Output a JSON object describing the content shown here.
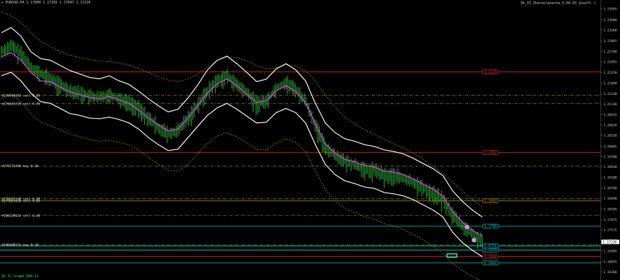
{
  "window": {
    "symbol_header": "EURUSD,H4",
    "ohlc": "1.17880 1.17256 1.17047 1.17226",
    "indicator_name": "Zb_33_Zhuravlenecha_V-04-03_1bsoft ⓘ"
  },
  "colors": {
    "background": "#000000",
    "candle": "#2ecc40",
    "bands": "#ffffff",
    "ma": "#ff33ff",
    "trend": "#8a8a00",
    "support": "#ff2a2a",
    "cyan": "#00d8e0",
    "gold": "#c8a000"
  },
  "price_axis": {
    "min": 1.1612,
    "max": 1.2425,
    "ticks": [
      "1.24250",
      "1.23995",
      "1.23680",
      "1.23380",
      "1.23065",
      "1.22760",
      "1.22455",
      "1.22150",
      "1.21840",
      "1.21530",
      "1.21230",
      "1.20925",
      "1.20620",
      "1.20320",
      "1.20005",
      "1.19700",
      "1.19410",
      "1.19100",
      "1.18790",
      "1.18490",
      "1.18185",
      "1.17875",
      "1.17575",
      "1.17265",
      "1.16965",
      "1.16655",
      "1.16360"
    ],
    "current_price": "1.17226"
  },
  "price_lines": [
    {
      "price": 1.2216,
      "color": "#ff2a2a",
      "style": "solid",
      "label": "1.2216",
      "tag_color": "#ff2a2a"
    },
    {
      "price": 1.2148,
      "color": "#8a7a00",
      "style": "dashed",
      "label": "",
      "tag_color": ""
    },
    {
      "price": 1.2124,
      "color": "#8a7a00",
      "style": "dashed",
      "label": "",
      "tag_color": ""
    },
    {
      "price": 1.1982,
      "color": "#ff2a2a",
      "style": "solid",
      "label": "1.1982",
      "tag_color": "#ff2a2a"
    },
    {
      "price": 1.1943,
      "color": "#8a7a00",
      "style": "dashed",
      "label": "",
      "tag_color": ""
    },
    {
      "price": 1.1848,
      "color": "#c8a000",
      "style": "dashed",
      "label": "",
      "tag_color": ""
    },
    {
      "price": 1.1842,
      "color": "#c8a000",
      "style": "solid",
      "label": "1.1842",
      "tag_color": "#c8a000"
    },
    {
      "price": 1.1799,
      "color": "#8a7a00",
      "style": "dashed",
      "label": "",
      "tag_color": ""
    },
    {
      "price": 1.1768,
      "color": "#00d8e0",
      "style": "solid",
      "label": "1.1768",
      "tag_color": "#00d8e0"
    },
    {
      "price": 1.1714,
      "color": "#8a7a00",
      "style": "dashed",
      "label": "",
      "tag_color": ""
    },
    {
      "price": 1.1711,
      "color": "#00d8e0",
      "style": "solid",
      "label": "1.1711",
      "tag_color": "#00d8e0"
    },
    {
      "price": 1.1699,
      "color": "#00d8e0",
      "style": "solid",
      "label": "1.1699",
      "tag_color": "#00d8e0"
    },
    {
      "price": 1.168,
      "color": "#ff2a2a",
      "style": "solid",
      "label": "1.1680",
      "tag_color": "#ff2a2a"
    },
    {
      "price": 1.1662,
      "color": "#00d8e0",
      "style": "solid",
      "label": "1.1662",
      "tag_color": "#00d8e0"
    }
  ],
  "order_labels": [
    {
      "price": 1.2148,
      "text": "#278694583 sell 0.05"
    },
    {
      "price": 1.2124,
      "text": "#278651519 sell 0.05"
    },
    {
      "price": 1.1943,
      "text": "#279273496 buy 0.30"
    },
    {
      "price": 1.1848,
      "text": "#278651540 sell 0.05"
    },
    {
      "price": 1.1842,
      "text": "#279051636 sell 0.05"
    },
    {
      "price": 1.1799,
      "text": "#280239632 sell 0.05"
    },
    {
      "price": 1.1714,
      "text": "#280408151 buy 0.30"
    }
  ],
  "footer_label": "Zb Ti Graph_V04-11",
  "chart_data": {
    "type": "line",
    "y_unit": "EURUSD price",
    "ylim": [
      1.1612,
      1.2425
    ],
    "series": [
      {
        "name": "",
        "role": "candle-mid",
        "values": [
          1.2275,
          1.2292,
          1.2268,
          1.223,
          1.221,
          1.2195,
          1.2178,
          1.2162,
          1.2155,
          1.2145,
          1.214,
          1.215,
          1.2138,
          1.2128,
          1.211,
          1.208,
          1.2055,
          1.2035,
          1.2045,
          1.208,
          1.212,
          1.216,
          1.219,
          1.2205,
          1.2178,
          1.2155,
          1.2125,
          1.213,
          1.2168,
          1.2185,
          1.2165,
          1.213,
          1.206,
          1.1998,
          1.1975,
          1.1955,
          1.1948,
          1.193,
          1.1932,
          1.1915,
          1.1915,
          1.1905,
          1.1895,
          1.1878,
          1.1864,
          1.1845,
          1.18,
          1.1768,
          1.1745,
          1.1722
        ]
      },
      {
        "name": "",
        "role": "ma",
        "values": [
          1.226,
          1.2272,
          1.225,
          1.2215,
          1.219,
          1.2188,
          1.2172,
          1.2158,
          1.215,
          1.2142,
          1.2138,
          1.2145,
          1.2135,
          1.2125,
          1.2105,
          1.2082,
          1.2062,
          1.2045,
          1.205,
          1.2082,
          1.2118,
          1.2155,
          1.2182,
          1.2196,
          1.2176,
          1.2152,
          1.2128,
          1.2132,
          1.2162,
          1.2176,
          1.216,
          1.2128,
          1.2065,
          1.2008,
          1.198,
          1.1962,
          1.1955,
          1.1945,
          1.194,
          1.1928,
          1.1925,
          1.1918,
          1.1905,
          1.189,
          1.1876,
          1.1855,
          1.181,
          1.178,
          1.1756,
          1.174
        ]
      },
      {
        "name": "",
        "role": "upper-band",
        "values": [
          1.233,
          1.2345,
          1.232,
          1.2275,
          1.2255,
          1.225,
          1.2235,
          1.222,
          1.221,
          1.22,
          1.2196,
          1.2205,
          1.219,
          1.218,
          1.216,
          1.2138,
          1.2118,
          1.21,
          1.2108,
          1.214,
          1.2178,
          1.2222,
          1.225,
          1.2262,
          1.224,
          1.2215,
          1.2188,
          1.2195,
          1.2225,
          1.224,
          1.2222,
          1.219,
          1.2125,
          1.2068,
          1.204,
          1.2022,
          1.2015,
          1.2005,
          1.2,
          1.199,
          1.1985,
          1.1978,
          1.1965,
          1.195,
          1.1935,
          1.1915,
          1.187,
          1.184,
          1.1815,
          1.1795
        ]
      },
      {
        "name": "",
        "role": "lower-band",
        "values": [
          1.2205,
          1.2215,
          1.219,
          1.2155,
          1.213,
          1.2125,
          1.211,
          1.2095,
          1.209,
          1.2082,
          1.208,
          1.2085,
          1.2078,
          1.2068,
          1.205,
          1.2025,
          1.2005,
          1.1988,
          1.1992,
          1.2025,
          1.2058,
          1.209,
          1.2112,
          1.2125,
          1.2108,
          1.2088,
          1.2068,
          1.207,
          1.2098,
          1.211,
          1.2098,
          1.2068,
          1.2005,
          1.1948,
          1.1918,
          1.19,
          1.1892,
          1.1882,
          1.1878,
          1.1866,
          1.1862,
          1.1856,
          1.1845,
          1.183,
          1.1815,
          1.1795,
          1.175,
          1.172,
          1.1698,
          1.168
        ]
      },
      {
        "name": "",
        "role": "trend-upper",
        "values": [
          1.239,
          1.238,
          1.236,
          1.233,
          1.2305,
          1.229,
          1.2275,
          1.2265,
          1.2258,
          1.2252,
          1.2248,
          1.2246,
          1.2242,
          1.2236,
          1.2226,
          1.2214,
          1.2202,
          1.2192,
          1.2188,
          1.2195,
          1.221,
          1.2232,
          1.225,
          1.226,
          1.2258,
          1.2248,
          1.2234,
          1.2226,
          1.2228,
          1.2236,
          1.2234,
          1.222,
          1.219,
          1.215,
          1.2115,
          1.2085,
          1.2065,
          1.2048,
          1.2035,
          1.202,
          1.2008,
          1.1995,
          1.198,
          1.1962,
          1.1942,
          1.1922,
          1.1895,
          1.187,
          1.1845,
          1.1825
        ]
      },
      {
        "name": "",
        "role": "trend-lower",
        "values": [
          1.214,
          1.215,
          1.213,
          1.2095,
          1.207,
          1.206,
          1.2048,
          1.2035,
          1.2028,
          1.202,
          1.2015,
          1.2018,
          1.2012,
          1.2004,
          1.199,
          1.1968,
          1.1948,
          1.193,
          1.1928,
          1.1948,
          1.1978,
          1.2008,
          1.203,
          1.204,
          1.2028,
          1.201,
          1.1992,
          1.199,
          1.201,
          1.2022,
          1.2012,
          1.1985,
          1.193,
          1.1875,
          1.1842,
          1.182,
          1.1808,
          1.1796,
          1.1788,
          1.1776,
          1.1768,
          1.1758,
          1.1744,
          1.1728,
          1.171,
          1.169,
          1.166,
          1.164,
          1.1622,
          1.1608
        ]
      }
    ]
  }
}
